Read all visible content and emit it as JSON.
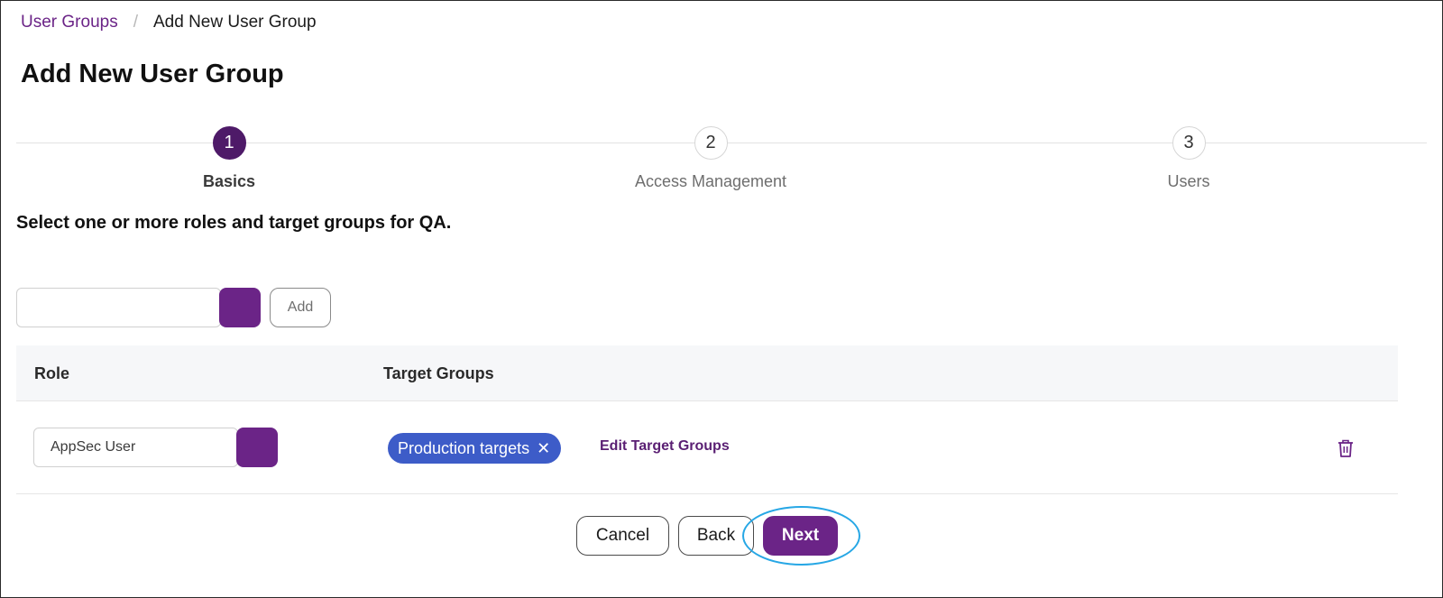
{
  "breadcrumb": {
    "parent": "User Groups",
    "separator": "/",
    "current": "Add New User Group"
  },
  "page": {
    "title": "Add New User Group",
    "instruction": "Select one or more roles and target groups for QA."
  },
  "steps": [
    {
      "number": "1",
      "label": "Basics",
      "active": true
    },
    {
      "number": "2",
      "label": "Access Management",
      "active": false
    },
    {
      "number": "3",
      "label": "Users",
      "active": false
    }
  ],
  "role_picker": {
    "value": "",
    "add_label": "Add"
  },
  "table": {
    "headers": {
      "role": "Role",
      "target_groups": "Target Groups"
    },
    "rows": [
      {
        "role": "AppSec User",
        "chips": [
          {
            "label": "Production targets",
            "remove_icon": "close-icon"
          }
        ],
        "edit_label": "Edit Target Groups",
        "delete_icon": "trash-icon"
      }
    ]
  },
  "footer": {
    "cancel": "Cancel",
    "back": "Back",
    "next": "Next"
  },
  "colors": {
    "brand": "#6b2487",
    "active_step": "#4e1a68",
    "chip": "#3d5cc8",
    "highlight": "#27a7e5"
  }
}
